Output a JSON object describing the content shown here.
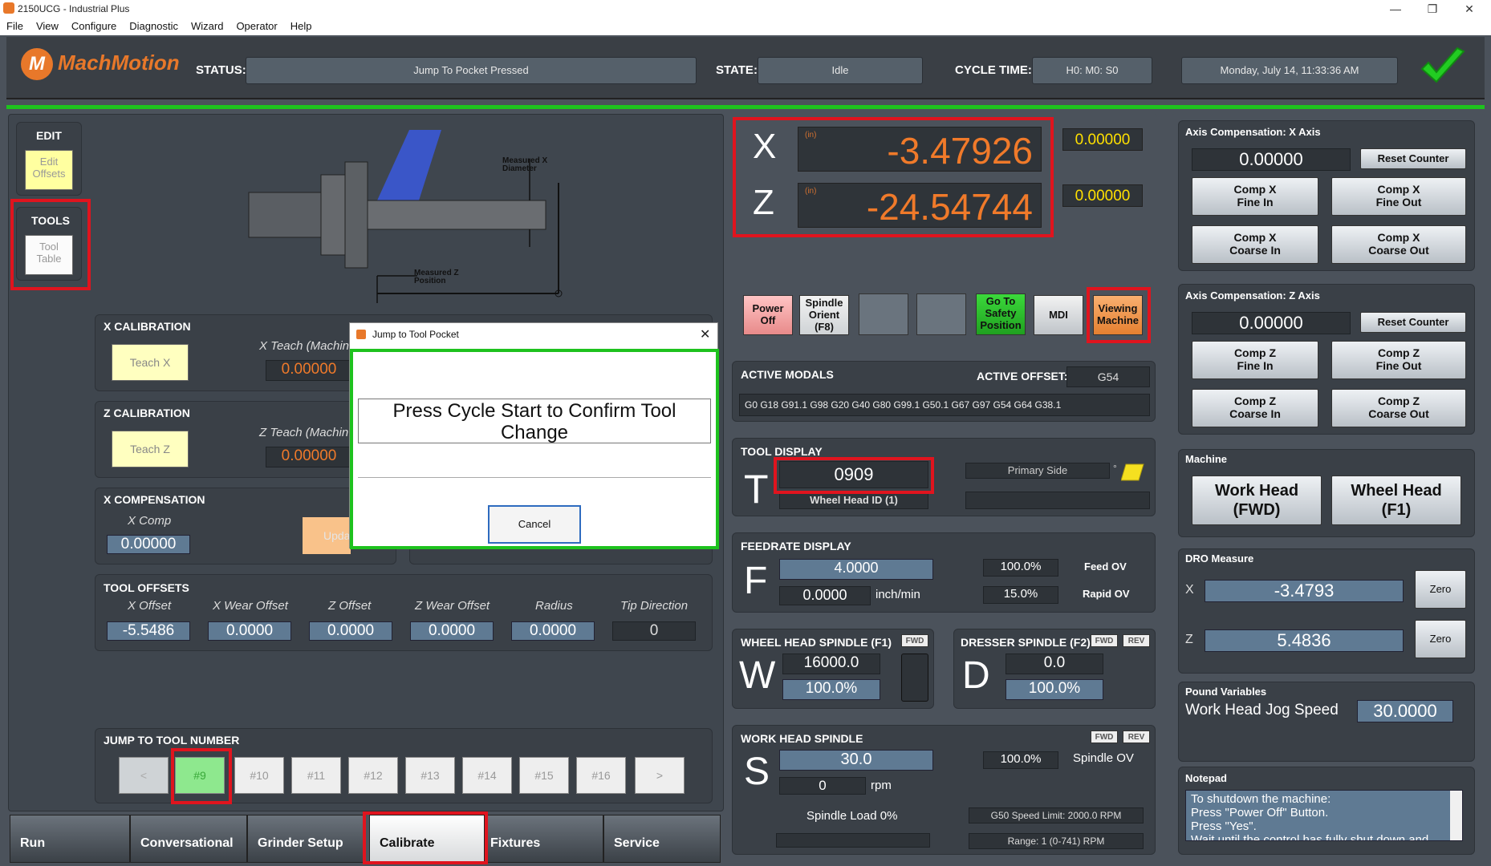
{
  "window": {
    "title": "2150UCG - Industrial Plus"
  },
  "menu": [
    "File",
    "View",
    "Configure",
    "Diagnostic",
    "Wizard",
    "Operator",
    "Help"
  ],
  "header": {
    "logo": "MachMotion",
    "status_label": "STATUS:",
    "status": "Jump To Pocket Pressed",
    "state_label": "STATE:",
    "state": "Idle",
    "cycle_label": "CYCLE TIME:",
    "cycle": "H0: M0: S0",
    "datetime": "Monday, July 14, 11:33:36 AM"
  },
  "left": {
    "edit": {
      "title": "EDIT",
      "button": "Edit\nOffsets"
    },
    "tools": {
      "title": "TOOLS",
      "button": "Tool\nTable"
    },
    "diagram": {
      "meas_x": "Measured X\nDiameter",
      "meas_z": "Measured Z\nPosition"
    },
    "x_cal": {
      "title": "X CALIBRATION",
      "button": "Teach X",
      "teach_label": "X Teach (Machin",
      "value": "0.00000"
    },
    "z_cal": {
      "title": "Z CALIBRATION",
      "button": "Teach Z",
      "teach_label": "Z Teach (Machin",
      "value": "0.00000"
    },
    "x_comp": {
      "title": "X COMPENSATION",
      "label": "X Comp",
      "value": "0.00000",
      "update": "Upda"
    },
    "tool_offsets": {
      "title": "TOOL OFFSETS",
      "headers": [
        "X Offset",
        "X Wear Offset",
        "Z Offset",
        "Z Wear Offset",
        "Radius",
        "Tip Direction"
      ],
      "values": [
        "-5.5486",
        "0.0000",
        "0.0000",
        "0.0000",
        "0.0000",
        "0"
      ]
    },
    "jump": {
      "title": "JUMP TO TOOL NUMBER",
      "items": [
        "<",
        "#9",
        "#10",
        "#11",
        "#12",
        "#13",
        "#14",
        "#15",
        "#16",
        ">"
      ]
    }
  },
  "tabs": [
    "Run",
    "Conversational",
    "Grinder Setup",
    "Calibrate",
    "Fixtures",
    "Service"
  ],
  "dialog": {
    "title": "Jump to Tool Pocket",
    "message": "Press Cycle Start to Confirm Tool Change",
    "cancel": "Cancel"
  },
  "dro": {
    "x_axis": "X",
    "x_unit": "(in)",
    "x_value": "-3.47926",
    "x_side": "0.00000",
    "z_axis": "Z",
    "z_unit": "(in)",
    "z_value": "-24.54744",
    "z_side": "0.00000"
  },
  "buttons": {
    "power": "Power\nOff",
    "orient": "Spindle\nOrient\n(F8)",
    "safety": "Go To\nSafety\nPosition",
    "mdi": "MDI",
    "viewing": "Viewing\nMachine"
  },
  "modals": {
    "title": "ACTIVE MODALS",
    "offset_label": "ACTIVE OFFSET:",
    "offset": "G54",
    "codes": "G0 G18 G91.1 G98 G20 G40 G80 G99.1 G50.1 G67 G97 G54 G64 G38.1"
  },
  "tool_display": {
    "title": "TOOL DISPLAY",
    "letter": "T",
    "tool": "0909",
    "wheel_head": "Wheel Head ID (1)",
    "side": "Primary Side",
    "deg": "°"
  },
  "feedrate": {
    "title": "FEEDRATE DISPLAY",
    "letter": "F",
    "feed": "4.0000",
    "actual": "0.0000",
    "unit": "inch/min",
    "feed_ov": "100.0%",
    "feed_ov_label": "Feed OV",
    "rapid_ov": "15.0%",
    "rapid_ov_label": "Rapid OV"
  },
  "wheel_spindle": {
    "title": "WHEEL HEAD SPINDLE (F1)",
    "fwd": "FWD",
    "letter": "W",
    "speed": "16000.0",
    "pct": "100.0%"
  },
  "dresser_spindle": {
    "title": "DRESSER SPINDLE (F2)",
    "fwd": "FWD",
    "rev": "REV",
    "letter": "D",
    "speed": "0.0",
    "pct": "100.0%"
  },
  "work_spindle": {
    "title": "WORK HEAD SPINDLE",
    "fwd": "FWD",
    "rev": "REV",
    "letter": "S",
    "speed": "30.0",
    "rpm_val": "0",
    "rpm": "rpm",
    "ov": "100.0%",
    "ov_label": "Spindle OV",
    "load": "Spindle Load 0%",
    "limit": "G50 Speed Limit: 2000.0 RPM",
    "range": "Range: 1 (0-741) RPM"
  },
  "comp_x": {
    "title": "Axis Compensation: X Axis",
    "value": "0.00000",
    "reset": "Reset Counter",
    "fine_in": "Comp X\nFine In",
    "fine_out": "Comp X\nFine Out",
    "coarse_in": "Comp X\nCoarse In",
    "coarse_out": "Comp X\nCoarse Out"
  },
  "comp_z": {
    "title": "Axis Compensation: Z Axis",
    "value": "0.00000",
    "reset": "Reset Counter",
    "fine_in": "Comp Z\nFine In",
    "fine_out": "Comp Z\nFine Out",
    "coarse_in": "Comp Z\nCoarse In",
    "coarse_out": "Comp Z\nCoarse Out"
  },
  "machine": {
    "title": "Machine",
    "work": "Work Head\n(FWD)",
    "wheel": "Wheel Head\n(F1)"
  },
  "dro_measure": {
    "title": "DRO Measure",
    "x_label": "X",
    "x": "-3.4793",
    "z_label": "Z",
    "z": "5.4836",
    "zero": "Zero"
  },
  "pound": {
    "title": "Pound Variables",
    "label": "Work Head Jog Speed",
    "value": "30.0000"
  },
  "notepad": {
    "title": "Notepad",
    "text": "To shutdown the machine:\nPress \"Power Off\" Button.\nPress \"Yes\".\nWait until the control has fully shut down and"
  },
  "colors": {
    "accent": "#e8782a",
    "green": "#1ec21e",
    "red": "#e0141e",
    "dro": "#f07a2a"
  }
}
